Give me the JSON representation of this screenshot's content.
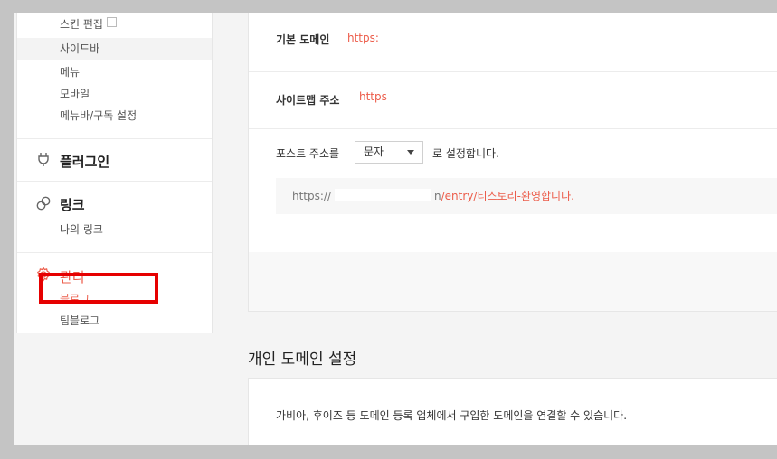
{
  "sidebar": {
    "skin_edit": "스킨 편집",
    "sidebar_item": "사이드바",
    "menu_item": "메뉴",
    "mobile_item": "모바일",
    "menubar_item": "메뉴바/구독 설정",
    "plugin_title": "플러그인",
    "link_title": "링크",
    "my_link": "나의 링크",
    "manage_title": "관리",
    "blog_item": "블로그",
    "teamblog_item": "팀블로그"
  },
  "settings": {
    "basic_domain_label": "기본 도메인",
    "basic_domain_value": "https:",
    "sitemap_label": "사이트맵 주소",
    "sitemap_value": "https",
    "post_address_label": "포스트 주소를",
    "post_address_select": "문자",
    "post_address_suffix": "로 설정합니다.",
    "example_url_prefix": "https://",
    "example_url_mid": "n",
    "example_url_path": "/entry/티스토리-환영합니다."
  },
  "personal_domain": {
    "title": "개인 도메인 설정",
    "description": "가비아, 후이즈 등 도메인 등록 업체에서 구입한 도메인을 연결할 수 있습니다."
  },
  "colors": {
    "accent": "#ec5c4a",
    "highlight": "#e60000"
  }
}
